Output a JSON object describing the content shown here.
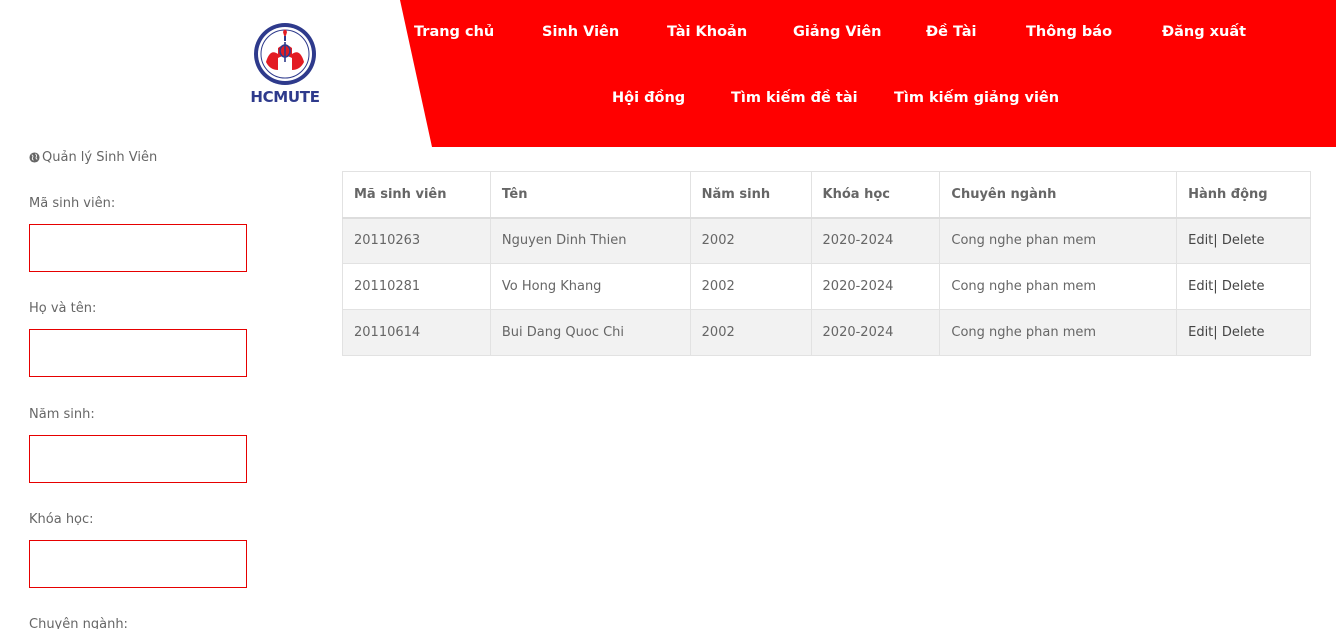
{
  "logo": {
    "text": "HCMUTE"
  },
  "nav": {
    "row1": [
      "Trang chủ",
      "Sinh Viên",
      "Tài Khoản",
      "Giảng Viên",
      "Đề Tài",
      "Thông báo",
      "Đăng xuất"
    ],
    "row2": [
      "Hội đồng",
      "Tìm kiếm đề tài",
      "Tìm kiếm giảng viên"
    ]
  },
  "form": {
    "title": "Quản lý Sinh Viên",
    "fields": [
      {
        "label": "Mã sinh viên:",
        "value": ""
      },
      {
        "label": "Họ và tên:",
        "value": ""
      },
      {
        "label": "Năm sinh:",
        "value": ""
      },
      {
        "label": "Khóa học:",
        "value": ""
      },
      {
        "label": "Chuyên ngành:",
        "value": ""
      }
    ]
  },
  "table": {
    "headers": [
      "Mã sinh viên",
      "Tên",
      "Năm sinh",
      "Khóa học",
      "Chuyên ngành",
      "Hành động"
    ],
    "rows": [
      {
        "id": "20110263",
        "name": "Nguyen Dinh Thien",
        "year": "2002",
        "course": "2020-2024",
        "major": "Cong nghe phan mem",
        "edit": "Edit",
        "sep": "|",
        "delete": "Delete"
      },
      {
        "id": "20110281",
        "name": "Vo Hong Khang",
        "year": "2002",
        "course": "2020-2024",
        "major": "Cong nghe phan mem",
        "edit": "Edit",
        "sep": "|",
        "delete": "Delete"
      },
      {
        "id": "20110614",
        "name": "Bui Dang Quoc Chi",
        "year": "2002",
        "course": "2020-2024",
        "major": "Cong nghe phan mem",
        "edit": "Edit",
        "sep": "|",
        "delete": "Delete"
      }
    ]
  },
  "colors": {
    "brand_red": "#ff0000",
    "logo_blue": "#2e3a8c",
    "input_border": "#e60000"
  },
  "icons": {
    "section": "globe-icon"
  }
}
